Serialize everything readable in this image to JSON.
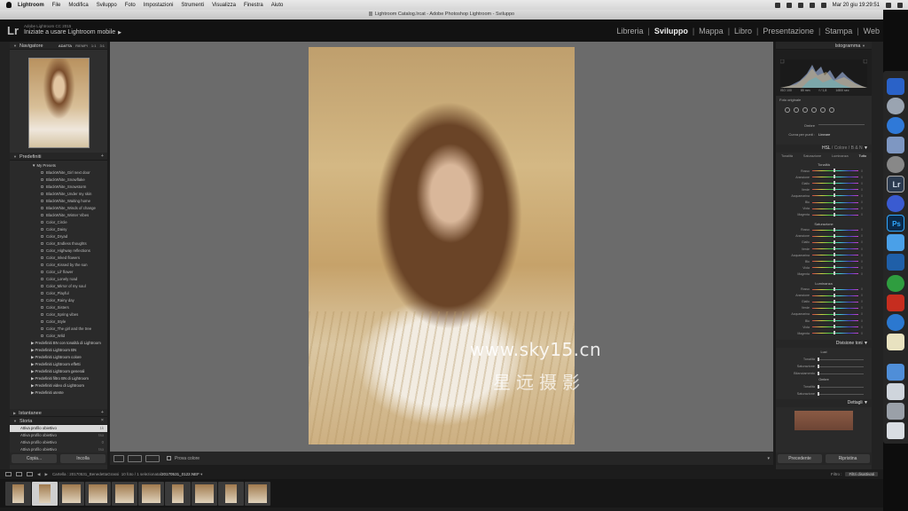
{
  "menubar": {
    "app": "Lightroom",
    "items": [
      "File",
      "Modifica",
      "Sviluppo",
      "Foto",
      "Impostazioni",
      "Strumenti",
      "Visualizza",
      "Finestra",
      "Aiuto"
    ],
    "clock": "Mar 20 giu  19:29:51"
  },
  "window_title": "Lightroom Catalog.lrcat - Adobe Photoshop Lightroom - Sviluppo",
  "identity": {
    "logo": "Lr",
    "subtitle": "Adobe Lightroom CC 2015",
    "mobile": "Iniziate a usare Lightroom mobile",
    "modules": [
      "Libreria",
      "Sviluppo",
      "Mappa",
      "Libro",
      "Presentazione",
      "Stampa",
      "Web"
    ],
    "active_module": "Sviluppo"
  },
  "left": {
    "navigator": {
      "title": "Navigatore",
      "options": [
        "ADATTA",
        "RIEMPI",
        "1:1",
        "3:1"
      ]
    },
    "presets": {
      "title": "Predefiniti",
      "folder": "My Presets",
      "items": [
        "BlackWhite_Girl next door",
        "BlackWhite_Snowflake",
        "BlackWhite_Snowstorm",
        "BlackWhite_Under my skin",
        "BlackWhite_Waiting home",
        "BlackWhite_Winds of change",
        "BlackWhite_Winter Vibes",
        "Color_Circle",
        "Color_Daisy",
        "Color_Dryad",
        "Color_Endless thoughts",
        "Color_Highway reflections",
        "Color_Inked flowers",
        "Color_Kissed by the sun",
        "Color_Lil' flower",
        "Color_Lonely road",
        "Color_Mirror of my soul",
        "Color_Playful",
        "Color_Rainy day",
        "Color_Sisters",
        "Color_Spring vibes",
        "Color_Style",
        "Color_The girl and the tree",
        "Color_Wild"
      ],
      "lr_folders": [
        "Predefiniti BN con tonalità di Lightroom",
        "Predefiniti Lightroom BN",
        "Predefiniti Lightroom colore",
        "Predefiniti Lightroom effetti",
        "Predefiniti Lightroom generali",
        "Predefiniti filtro BN di Lightroom",
        "Predefiniti video di Lightroom",
        "Predefiniti utente"
      ]
    },
    "snapshots": {
      "title": "Istantanee"
    },
    "history": {
      "title": "Storia",
      "items": [
        {
          "label": "Attiva profilo obiettivo",
          "value": "1k"
        },
        {
          "label": "Attiva profilo obiettivo",
          "value": "tso"
        },
        {
          "label": "Attiva profilo obiettivo",
          "value": "0"
        },
        {
          "label": "Attiva profilo obiettivo",
          "value": "tso"
        },
        {
          "label": "Attiva profilo obiettivo",
          "value": "0"
        }
      ]
    },
    "copy_btn": "Copia...",
    "paste_btn": "Incolla"
  },
  "center": {
    "watermark_url": "www.sky15.cn",
    "watermark_cn": "星远摄影",
    "toolbar_label": "Prova colore"
  },
  "right": {
    "histogram": {
      "title": "Istogramma",
      "iso": "ISO 100",
      "focal": "85 mm",
      "aperture": "f / 1,8",
      "shutter": "1/800 sec"
    },
    "original_photo": "Foto originale",
    "curve": {
      "label1": "Ombre",
      "label2": "Curva per punti :",
      "value2": "Lineare"
    },
    "hsl": {
      "header_parts": [
        "HSL",
        " / ",
        "Colore",
        " / ",
        "B & N"
      ],
      "tabs": [
        "Tonalità",
        "Saturazione",
        "Luminanza",
        "Tutto"
      ],
      "groups": [
        "Tonalità",
        "Saturazione",
        "Luminanza"
      ],
      "rows": [
        "Rosso",
        "Arancione",
        "Giallo",
        "Verde",
        "Acquamarina",
        "Blu",
        "Viola",
        "Magenta"
      ],
      "row_values": [
        "0",
        "0",
        "0",
        "0",
        "0",
        "0",
        "0",
        "0"
      ]
    },
    "split": {
      "title": "Divisione toni",
      "highlights": "Luci",
      "hue": "Tonalità",
      "saturation": "Saturazione",
      "balance": "Bilanciamento",
      "shadows": "Ombre"
    },
    "details": {
      "title": "Dettagli"
    },
    "prev_btn": "Precedente",
    "reset_btn": "Ripristina"
  },
  "filmstrip": {
    "path_prefix": "Cartella : 20170531_BenedettaGrassi",
    "count": "10 foto / 1 selezionata",
    "file": "/20170531_0122.NEF",
    "filter_label": "Filtro :",
    "filter_value": "Filtri disattivati"
  }
}
